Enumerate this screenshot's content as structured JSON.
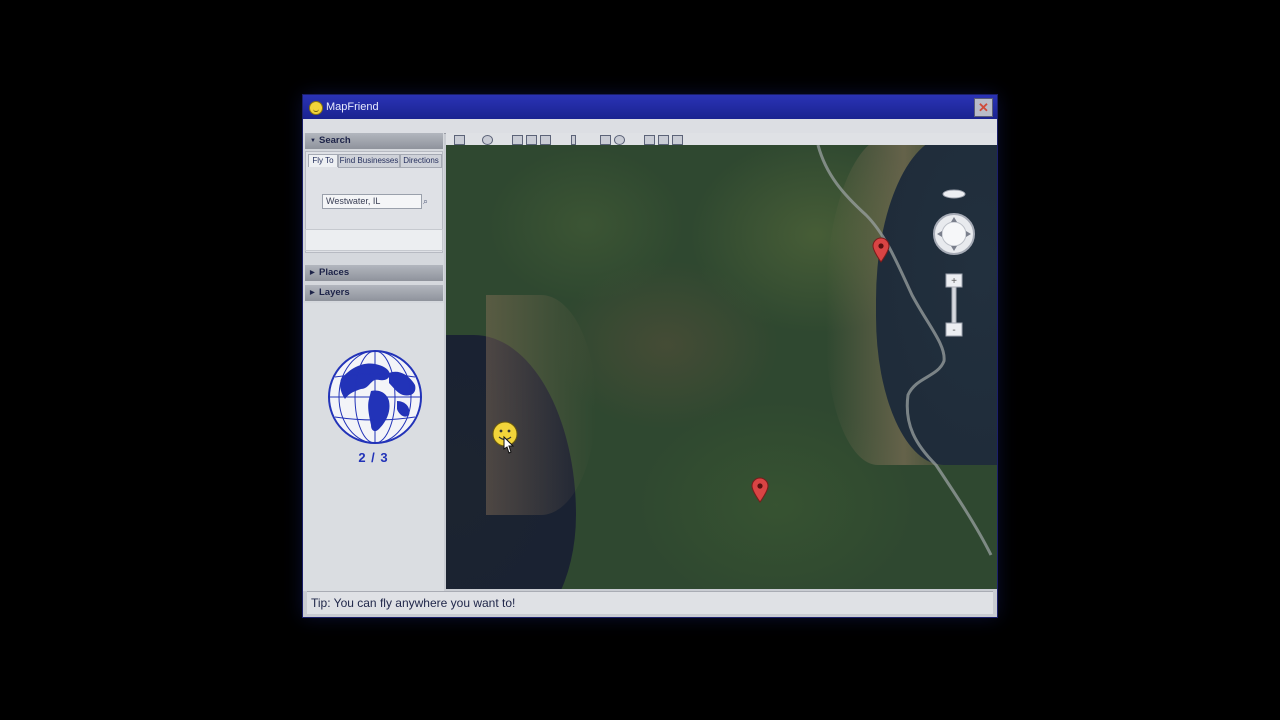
{
  "window": {
    "title": "MapFriend",
    "close_label": "✕"
  },
  "sidebar": {
    "search": {
      "header": "Search",
      "tabs": [
        {
          "label": "Fly To"
        },
        {
          "label": "Find Businesses"
        },
        {
          "label": "Directions"
        }
      ],
      "active_tab": "Fly To",
      "input_value": "Westwater, IL"
    },
    "places": {
      "header": "Places"
    },
    "layers": {
      "header": "Layers"
    },
    "globe_counter": "2 / 3"
  },
  "toolbar": {
    "icons": [
      "sidebar-toggle-icon",
      "placemark-icon",
      "polygon-icon",
      "path-icon",
      "overlay-icon",
      "ruler-icon",
      "image-icon",
      "record-icon",
      "email-icon",
      "print-icon",
      "map-view-icon"
    ]
  },
  "map": {
    "markers": [
      {
        "name": "marker-1"
      },
      {
        "name": "marker-2"
      }
    ]
  },
  "status": {
    "tip": "Tip: You can fly anywhere you want to!"
  },
  "colors": {
    "title_bar": "#1f2aa0",
    "globe": "#2233b8",
    "marker": "#d94444"
  }
}
